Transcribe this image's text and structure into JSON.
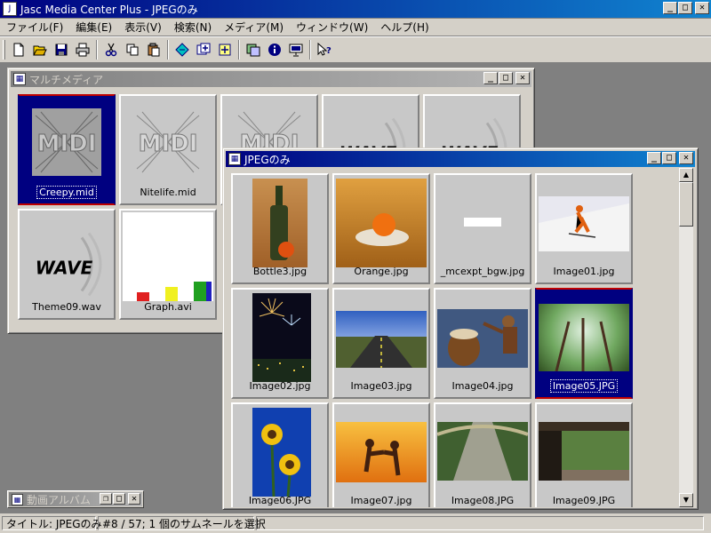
{
  "app": {
    "title": "Jasc Media Center Plus - JPEGのみ"
  },
  "menu": [
    {
      "label": "ファイル(F)"
    },
    {
      "label": "編集(E)"
    },
    {
      "label": "表示(V)"
    },
    {
      "label": "検索(N)"
    },
    {
      "label": "メディア(M)"
    },
    {
      "label": "ウィンドウ(W)"
    },
    {
      "label": "ヘルプ(H)"
    }
  ],
  "toolbar": {
    "icons": [
      "new-icon",
      "open-icon",
      "save-icon",
      "print-icon",
      "cut-icon",
      "copy-icon",
      "paste-icon",
      "find-icon",
      "add-icon",
      "import-icon",
      "slideshow-icon",
      "info-icon",
      "presentation-icon",
      "context-help-icon"
    ]
  },
  "multimedia_window": {
    "title": "マルチメディア",
    "items": [
      {
        "name": "Creepy.mid",
        "kind": "midi",
        "selected": true
      },
      {
        "name": "Nitelife.mid",
        "kind": "midi",
        "selected": false
      },
      {
        "name": "",
        "kind": "midi",
        "selected": false
      },
      {
        "name": "",
        "kind": "wave",
        "selected": false
      },
      {
        "name": "",
        "kind": "wave",
        "selected": false
      },
      {
        "name": "Theme09.wav",
        "kind": "wave",
        "selected": false
      },
      {
        "name": "Graph.avi",
        "kind": "avi",
        "selected": false
      }
    ],
    "wave_text": "WAVE"
  },
  "jpeg_window": {
    "title": "JPEGのみ",
    "items": [
      {
        "name": "Bottle3.jpg",
        "selected": false
      },
      {
        "name": "Orange.jpg",
        "selected": false
      },
      {
        "name": "_mcexpt_bgw.jpg",
        "selected": false
      },
      {
        "name": "Image01.jpg",
        "selected": false
      },
      {
        "name": "Image02.jpg",
        "selected": false
      },
      {
        "name": "Image03.jpg",
        "selected": false
      },
      {
        "name": "Image04.jpg",
        "selected": false
      },
      {
        "name": "Image05.JPG",
        "selected": true
      },
      {
        "name": "Image06.JPG",
        "selected": false
      },
      {
        "name": "Image07.jpg",
        "selected": false
      },
      {
        "name": "Image08.JPG",
        "selected": false
      },
      {
        "name": "Image09.JPG",
        "selected": false
      }
    ]
  },
  "minimized_window": {
    "title": "動画アルバム"
  },
  "status": {
    "title_panel": "タイトル: JPEGのみ",
    "selection_panel": "#8 / 57; 1 個のサムネールを選択"
  },
  "colors": {
    "title_active": "#000080",
    "title_inactive": "#808080",
    "face": "#d4d0c8",
    "workspace": "#808080",
    "selection": "#000080",
    "selection_border": "#c00000"
  }
}
